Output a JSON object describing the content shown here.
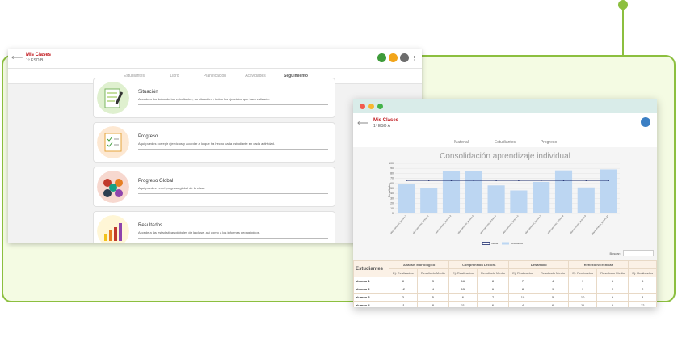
{
  "left_window": {
    "title": "Mis Clases",
    "subtitle": "1º ESO B",
    "tabs": [
      {
        "label": "Estudiantes"
      },
      {
        "label": "Libro"
      },
      {
        "label": "Planificación"
      },
      {
        "label": "Actividades"
      },
      {
        "label": "Seguimiento"
      }
    ],
    "active_tab": "Seguimiento",
    "cards": [
      {
        "title": "Situación",
        "desc": "Accede a los datos de tus estudiantes, su situación y todos los ejercicios que han realizado."
      },
      {
        "title": "Progreso",
        "desc": "Aquí puedes corregir ejercicios y acceder a lo que ha hecho cada estudiante en cada actividad."
      },
      {
        "title": "Progreso Global",
        "desc": "Aquí puedes ver el progreso global de la clase."
      },
      {
        "title": "Resultados",
        "desc": "Accede a las estadísticas globales de la clase, así como a los informes pedagógicos."
      }
    ]
  },
  "right_window": {
    "title": "Mis Clases",
    "subtitle": "1º ESO A",
    "tabs": [
      {
        "label": "Material"
      },
      {
        "label": "Estudiantes"
      },
      {
        "label": "Progreso"
      }
    ],
    "active_tab": "Progreso",
    "search_label": "Buscar:",
    "table": {
      "first_header": "Estudiantes",
      "groups": [
        "Análisis Morfológico",
        "Comprensión Lectora",
        "Desarrollo",
        "Reflexión/Técnicas"
      ],
      "subheaders": [
        "Ej. Realizados",
        "Resultado Medio",
        "Ej. Realizados",
        "Resultado Medio",
        "Ej. Realizados",
        "Resultado Medio",
        "Ej. Realizados",
        "Resultado Medio",
        "Ej. Realizados"
      ],
      "rows": [
        {
          "name": "alumno 1",
          "cells": [
            "8",
            "3",
            "16",
            "8",
            "7",
            "4",
            "9",
            "8",
            "5"
          ]
        },
        {
          "name": "alumno 2",
          "cells": [
            "12",
            "4",
            "15",
            "6",
            "8",
            "9",
            "9",
            "5",
            "2"
          ]
        },
        {
          "name": "alumno 3",
          "cells": [
            "3",
            "5",
            "6",
            "7",
            "10",
            "5",
            "10",
            "6",
            "4"
          ]
        },
        {
          "name": "alumno 4",
          "cells": [
            "11",
            "8",
            "11",
            "6",
            "4",
            "6",
            "11",
            "9",
            "12"
          ]
        }
      ]
    }
  },
  "chart_data": {
    "type": "bar",
    "title": "Consolidación aprendizaje individual",
    "ylabel": "Resultados",
    "ylim": [
      0,
      100
    ],
    "yticks": [
      0,
      10,
      20,
      30,
      40,
      50,
      60,
      70,
      80,
      90,
      100
    ],
    "categories": [
      "planeamiento_lectura 1",
      "planeamiento_lectura 2",
      "planeamiento_lectura 3",
      "planeamiento_lectura 4",
      "planeamiento_lectura 5",
      "planeamiento_lectura 6",
      "planeamiento_lectura 7",
      "planeamiento_lectura 8",
      "planeamiento_lectura 9",
      "planeamiento_lectura 10"
    ],
    "series": [
      {
        "name": "Resultados",
        "type": "bar",
        "color": "#bcd6f2",
        "values": [
          58,
          50,
          84,
          85,
          56,
          46,
          63,
          86,
          52,
          88
        ]
      },
      {
        "name": "Media",
        "type": "line",
        "color": "#1a2a6c",
        "values": [
          66,
          66,
          66,
          66,
          66,
          66,
          66,
          66,
          66,
          66
        ]
      }
    ],
    "legend": [
      "Media",
      "Resultados"
    ]
  }
}
